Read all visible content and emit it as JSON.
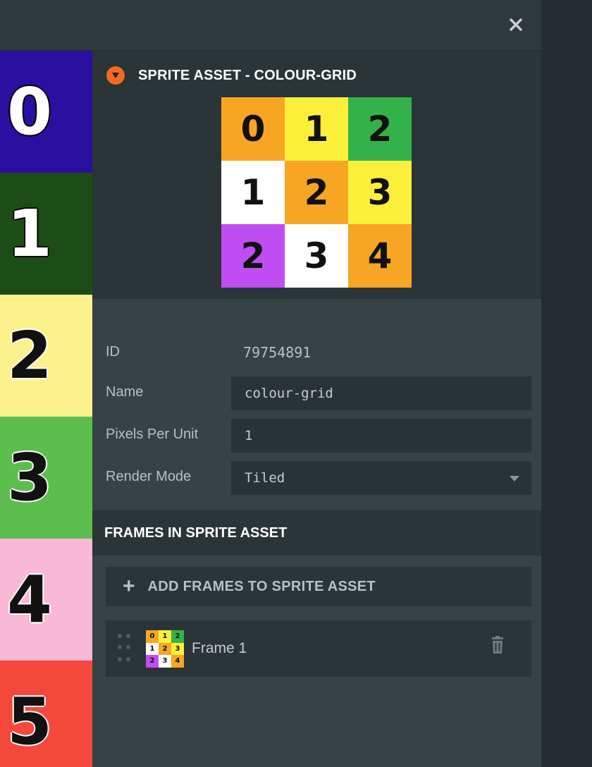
{
  "window": {
    "close_icon": "close-icon"
  },
  "texture_strip": {
    "cells": [
      {
        "label": "0",
        "bg": "#2a0fa0",
        "fg": "#ffffff",
        "outline": "#000000"
      },
      {
        "label": "1",
        "bg": "#1d4d16",
        "fg": "#ffffff",
        "outline": "#000000"
      },
      {
        "label": "2",
        "bg": "#fdf18c",
        "fg": "#111111",
        "outline": "#ffffff"
      },
      {
        "label": "3",
        "bg": "#5cbf4d",
        "fg": "#111111",
        "outline": "#ffffff"
      },
      {
        "label": "4",
        "bg": "#f9b8d6",
        "fg": "#111111",
        "outline": "#ffffff"
      },
      {
        "label": "5",
        "bg": "#f4483d",
        "fg": "#111111",
        "outline": "#ffffff"
      }
    ]
  },
  "asset": {
    "title": "SPRITE ASSET - COLOUR-GRID",
    "collapse_color": "#f26a21",
    "preview": [
      {
        "label": "0",
        "bg": "#f7a623"
      },
      {
        "label": "1",
        "bg": "#fcef3a"
      },
      {
        "label": "2",
        "bg": "#34b24a"
      },
      {
        "label": "1",
        "bg": "#ffffff"
      },
      {
        "label": "2",
        "bg": "#f7a623"
      },
      {
        "label": "3",
        "bg": "#fcef3a"
      },
      {
        "label": "2",
        "bg": "#bf4df2"
      },
      {
        "label": "3",
        "bg": "#ffffff"
      },
      {
        "label": "4",
        "bg": "#f7a623"
      }
    ]
  },
  "properties": {
    "id_label": "ID",
    "id_value": "79754891",
    "name_label": "Name",
    "name_value": "colour-grid",
    "ppu_label": "Pixels Per Unit",
    "ppu_value": "1",
    "render_label": "Render Mode",
    "render_value": "Tiled"
  },
  "frames": {
    "title": "FRAMES IN SPRITE ASSET",
    "add_label": "ADD FRAMES TO SPRITE ASSET",
    "add_icon": "plus-icon",
    "items": [
      {
        "name": "Frame 1"
      }
    ]
  }
}
